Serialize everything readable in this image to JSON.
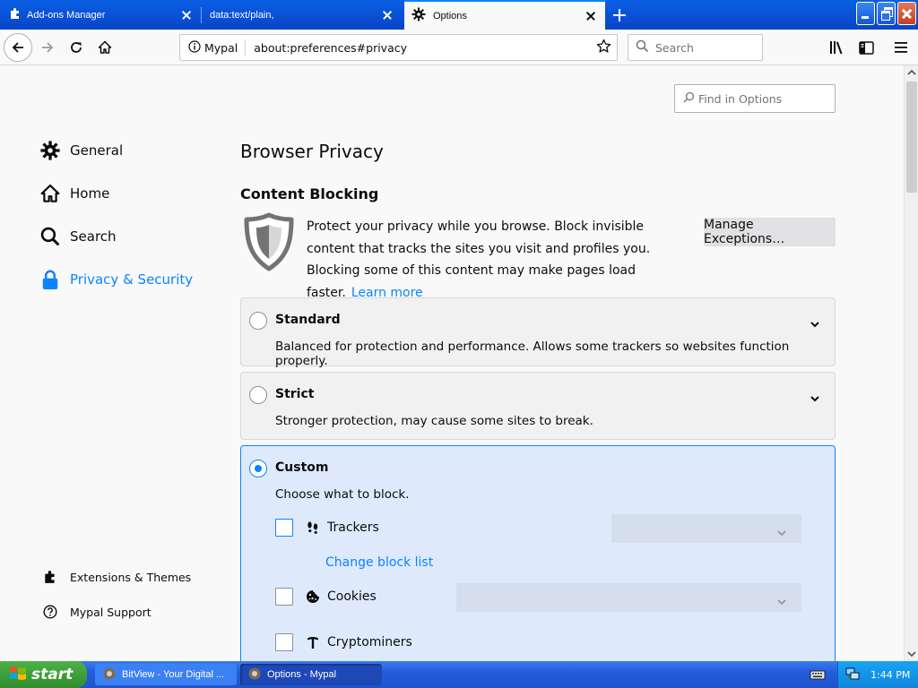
{
  "tabs": [
    {
      "label": "Add-ons Manager",
      "active": false
    },
    {
      "label": "data:text/plain,",
      "active": false
    },
    {
      "label": "Options",
      "active": true
    }
  ],
  "navbar": {
    "identity_label": "Mypal",
    "url": "about:preferences#privacy",
    "search_placeholder": "Search"
  },
  "find": {
    "placeholder": "Find in Options"
  },
  "sidebar": {
    "items": [
      {
        "label": "General",
        "icon": "gear-icon",
        "selected": false
      },
      {
        "label": "Home",
        "icon": "home-icon",
        "selected": false
      },
      {
        "label": "Search",
        "icon": "search-icon",
        "selected": false
      },
      {
        "label": "Privacy & Security",
        "icon": "lock-icon",
        "selected": true
      }
    ],
    "footer": [
      {
        "label": "Extensions & Themes",
        "icon": "puzzle-icon"
      },
      {
        "label": "Mypal Support",
        "icon": "help-icon"
      }
    ]
  },
  "main": {
    "title": "Browser Privacy",
    "section": "Content Blocking",
    "intro": "Protect your privacy while you browse. Block invisible content that tracks the sites you visit and profiles you. Blocking some of this content may make pages load faster.",
    "learn_more": "Learn more",
    "manage_exceptions": "Manage Exceptions…",
    "options": [
      {
        "name": "Standard",
        "desc": "Balanced for protection and performance. Allows some trackers so websites function properly.",
        "selected": false
      },
      {
        "name": "Strict",
        "desc": "Stronger protection, may cause some sites to break.",
        "selected": false
      },
      {
        "name": "Custom",
        "desc": "Choose what to block.",
        "selected": true
      }
    ],
    "custom": {
      "trackers": "Trackers",
      "change_block_list": "Change block list",
      "cookies": "Cookies",
      "cryptominers": "Cryptominers"
    }
  },
  "taskbar": {
    "start": "start",
    "tasks": [
      {
        "label": "BitView - Your Digital ...",
        "active": false
      },
      {
        "label": "Options - Mypal",
        "active": true
      }
    ],
    "clock": "1:44 PM"
  },
  "colors": {
    "accent": "#0a84ff",
    "xp_blue": "#245ddb",
    "start_green": "#3a9e37"
  }
}
